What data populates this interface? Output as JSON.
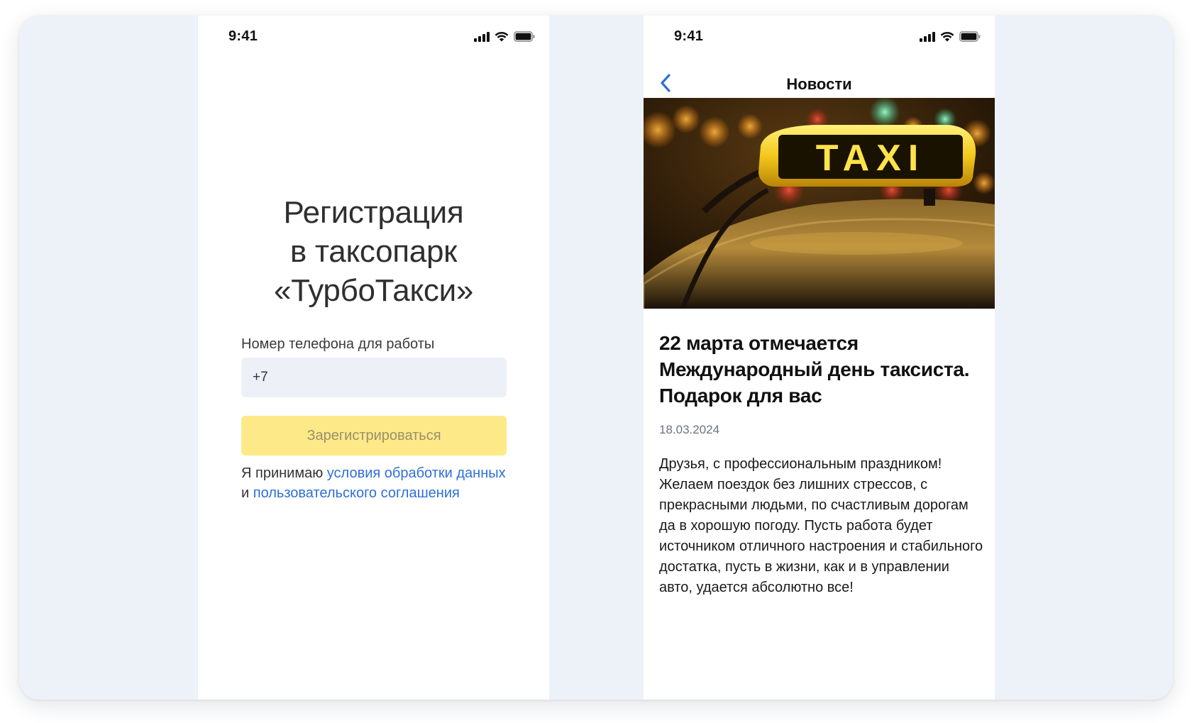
{
  "colors": {
    "stage_bg": "#edf2f9",
    "link": "#2e6fd8",
    "button_bg": "#fde988",
    "button_text": "#9a8f6a",
    "input_bg": "#edf1f7",
    "back_arrow": "#2e6fd8"
  },
  "registration_screen": {
    "status_bar": {
      "time": "9:41",
      "icons": [
        "cellular-signal-icon",
        "wifi-icon",
        "battery-icon"
      ]
    },
    "title_lines": [
      "Регистрация",
      "в таксопарк",
      "«ТурбоТакси»"
    ],
    "phone_field": {
      "label": "Номер телефона для работы",
      "value": "+7",
      "placeholder": ""
    },
    "register_button_label": "Зарегистрироваться",
    "terms": {
      "prefix": "Я принимаю ",
      "link1": "условия обработки данных",
      "middle": " и ",
      "link2": "пользовательского соглашения"
    }
  },
  "news_screen": {
    "status_bar": {
      "time": "9:41",
      "icons": [
        "cellular-signal-icon",
        "wifi-icon",
        "battery-icon"
      ]
    },
    "nav": {
      "title": "Новости",
      "back_icon": "chevron-left-icon"
    },
    "hero_image": {
      "sign_text": "TAXI"
    },
    "article": {
      "title": "22 марта отмечается Международный день таксиста. Подарок для вас",
      "date": "18.03.2024",
      "body": "Друзья, с профессиональным праздником! Желаем поездок без лишних стрессов, с прекрасными людьми, по счастливым дорогам да в хорошую погоду. Пусть работа будет источником отличного настроения и стабильного достатка, пусть в жизни, как и в управлении авто, удается абсолютно все!"
    }
  }
}
